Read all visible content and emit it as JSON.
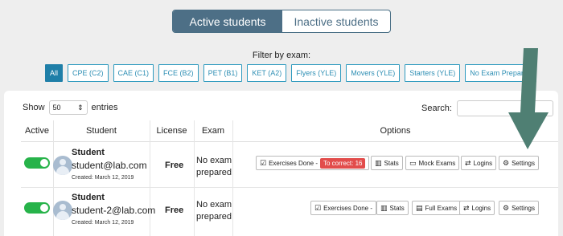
{
  "tabs": {
    "active": "Active students",
    "inactive": "Inactive students"
  },
  "filter": {
    "label": "Filter by exam:",
    "chips": [
      "All",
      "CPE (C2)",
      "CAE (C1)",
      "FCE (B2)",
      "PET (B1)",
      "KET (A2)",
      "Flyers (YLE)",
      "Movers (YLE)",
      "Starters (YLE)",
      "No Exam Prepared"
    ]
  },
  "table": {
    "show_label": "Show",
    "entries_value": "50",
    "entries_label": "entries",
    "search_label": "Search:",
    "headers": {
      "active": "Active",
      "student": "Student",
      "license": "License",
      "exam": "Exam",
      "options": "Options"
    }
  },
  "rows": [
    {
      "name": "Student",
      "email": "student@lab.com",
      "created": "Created: March 12, 2019",
      "license": "Free",
      "exam_line1": "No exam",
      "exam_line2": "prepared",
      "exercises": "Exercises Done -",
      "correct": "To correct: 16",
      "stats": "Stats",
      "exams_btn": "Mock Exams",
      "logins": "Logins",
      "settings": "Settings"
    },
    {
      "name": "Student",
      "email": "student-2@lab.com",
      "created": "Created: March 12, 2019",
      "license": "Free",
      "exam_line1": "No exam",
      "exam_line2": "prepared",
      "exercises": "Exercises Done -",
      "stats": "Stats",
      "exams_btn": "Full Exams",
      "logins": "Logins",
      "settings": "Settings"
    }
  ],
  "colors": {
    "accent": "#4d6f86",
    "chip": "#2f9bbf",
    "toggle": "#27b34a",
    "badge": "#e24c4b",
    "arrow": "#4f7f73"
  },
  "icons": {
    "sort": "sort-icon",
    "check": "check-square-icon",
    "stats": "bar-chart-icon",
    "laptop": "laptop-icon",
    "exchange": "exchange-icon",
    "gear": "gear-icon",
    "file": "file-icon",
    "arrow": "down-arrow-icon"
  }
}
